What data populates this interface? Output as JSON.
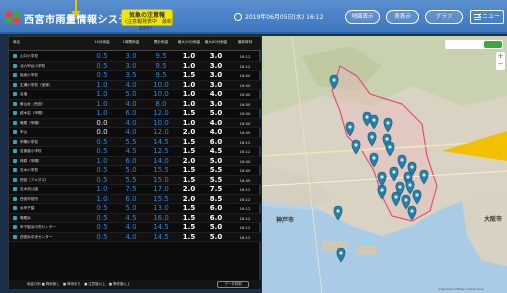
{
  "header": {
    "title": "西宮市雨量情報システム",
    "alert_badge": {
      "line1": "気象の注意報",
      "line2": "（注意報発表中　最新10分）"
    },
    "datetime": "2019年06月05日(水) 16:12",
    "buttons": [
      "地図表示",
      "表表示",
      "グラフ",
      "メニュー"
    ],
    "accent_color": "#f3e600"
  },
  "table": {
    "columns": [
      "局名",
      "10分雨量",
      "1時間雨量",
      "累計雨量",
      "最大10分雨量",
      "最大60分雨量",
      "最新時刻"
    ],
    "rows": [
      {
        "name": "山口小学校",
        "v": [
          "0.5",
          "3.0",
          "9.5",
          "1.0",
          "3.0",
          "16:12"
        ],
        "c": [
          "b",
          "b",
          "b",
          "w",
          "w",
          "t"
        ]
      },
      {
        "name": "北六甲台小学校",
        "v": [
          "0.5",
          "3.0",
          "9.5",
          "1.0",
          "3.0",
          "16:12"
        ],
        "c": [
          "b",
          "b",
          "b",
          "w",
          "w",
          "t"
        ]
      },
      {
        "name": "船坂小学校",
        "v": [
          "0.5",
          "3.5",
          "9.5",
          "1.5",
          "3.0",
          "16:00"
        ],
        "c": [
          "b",
          "b",
          "b",
          "w",
          "w",
          "t"
        ]
      },
      {
        "name": "生瀬小学校（宝塚）",
        "v": [
          "1.0",
          "4.0",
          "10.0",
          "1.0",
          "3.0",
          "16:00"
        ],
        "c": [
          "b",
          "b",
          "b",
          "w",
          "w",
          "t"
        ]
      },
      {
        "name": "名塩",
        "v": [
          "1.0",
          "5.0",
          "10.0",
          "1.0",
          "4.0",
          "16:00"
        ],
        "c": [
          "b",
          "b",
          "b",
          "w",
          "w",
          "t"
        ]
      },
      {
        "name": "東山台（西宮）",
        "v": [
          "1.0",
          "4.0",
          "8.0",
          "1.0",
          "3.0",
          "16:00"
        ],
        "c": [
          "b",
          "b",
          "b",
          "w",
          "w",
          "t"
        ]
      },
      {
        "name": "越木岩（甲陽）",
        "v": [
          "1.0",
          "6.0",
          "12.0",
          "1.5",
          "5.0",
          "16:00"
        ],
        "c": [
          "b",
          "b",
          "b",
          "w",
          "w",
          "t"
        ]
      },
      {
        "name": "鳴尾（甲陽）",
        "v": [
          "0.0",
          "4.0",
          "10.0",
          "1.0",
          "4.0",
          "16:00"
        ],
        "c": [
          "l",
          "b",
          "b",
          "w",
          "w",
          "t"
        ]
      },
      {
        "name": "甲山",
        "v": [
          "0.0",
          "4.0",
          "12.0",
          "2.0",
          "4.0",
          "16:00"
        ],
        "c": [
          "l",
          "b",
          "b",
          "w",
          "w",
          "t"
        ]
      },
      {
        "name": "甲陽小学校",
        "v": [
          "0.5",
          "5.5",
          "14.5",
          "1.5",
          "6.0",
          "16:12"
        ],
        "c": [
          "b",
          "b",
          "b",
          "w",
          "w",
          "t"
        ]
      },
      {
        "name": "苦楽園小学校",
        "v": [
          "0.5",
          "4.5",
          "12.5",
          "1.5",
          "4.5",
          "16:12"
        ],
        "c": [
          "b",
          "b",
          "b",
          "w",
          "w",
          "t"
        ]
      },
      {
        "name": "神原（甲陽）",
        "v": [
          "1.0",
          "6.0",
          "14.0",
          "2.0",
          "5.0",
          "16:00"
        ],
        "c": [
          "b",
          "b",
          "b",
          "w",
          "w",
          "t"
        ]
      },
      {
        "name": "瓦木小学校",
        "v": [
          "0.5",
          "5.0",
          "15.5",
          "1.5",
          "5.5",
          "16:00"
        ],
        "c": [
          "b",
          "b",
          "b",
          "w",
          "w",
          "t"
        ]
      },
      {
        "name": "西宮（アメダス）",
        "v": [
          "0.5",
          "5.5",
          "15.0",
          "1.5",
          "5.5",
          "16:00"
        ],
        "c": [
          "b",
          "b",
          "b",
          "w",
          "w",
          "t"
        ]
      },
      {
        "name": "瓦木西公園",
        "v": [
          "1.0",
          "7.5",
          "17.0",
          "2.0",
          "7.5",
          "16:12"
        ],
        "c": [
          "b",
          "b",
          "b",
          "w",
          "w",
          "t"
        ]
      },
      {
        "name": "西宮市役所",
        "v": [
          "1.0",
          "6.0",
          "15.5",
          "2.0",
          "8.5",
          "16:12"
        ],
        "c": [
          "b",
          "b",
          "b",
          "w",
          "w",
          "t"
        ]
      },
      {
        "name": "浜甲子園",
        "v": [
          "0.5",
          "5.0",
          "13.0",
          "1.5",
          "6.0",
          "16:12"
        ],
        "c": [
          "b",
          "b",
          "b",
          "w",
          "w",
          "t"
        ]
      },
      {
        "name": "鳴尾浜",
        "v": [
          "0.5",
          "4.5",
          "16.0",
          "1.5",
          "6.0",
          "16:12"
        ],
        "c": [
          "b",
          "b",
          "b",
          "w",
          "w",
          "t"
        ]
      },
      {
        "name": "甲子園浜中央センター",
        "v": [
          "0.5",
          "4.0",
          "14.5",
          "1.5",
          "5.0",
          "16:12"
        ],
        "c": [
          "b",
          "b",
          "b",
          "w",
          "w",
          "t"
        ]
      },
      {
        "name": "西宮浜中央センター",
        "v": [
          "0.5",
          "4.0",
          "14.5",
          "1.5",
          "5.0",
          "16:12"
        ],
        "c": [
          "b",
          "b",
          "b",
          "w",
          "w",
          "t"
        ]
      }
    ],
    "legend_text": "雨量凡例 ■ 降雨無し　■ 降雨あり　■ 注意値以上　■ 警戒値以上",
    "legend_button": "データ説明"
  },
  "map": {
    "places": [
      "神戸市",
      "大阪市"
    ],
    "control_label": "地図表示切替",
    "zoom_in": "+",
    "zoom_out": "−",
    "copyright": "©OpenStreetMap contributors"
  },
  "colors": {
    "blue_value": "#2b86d8",
    "marker": "#2a7fa6",
    "city_outline": "#e0527a"
  }
}
